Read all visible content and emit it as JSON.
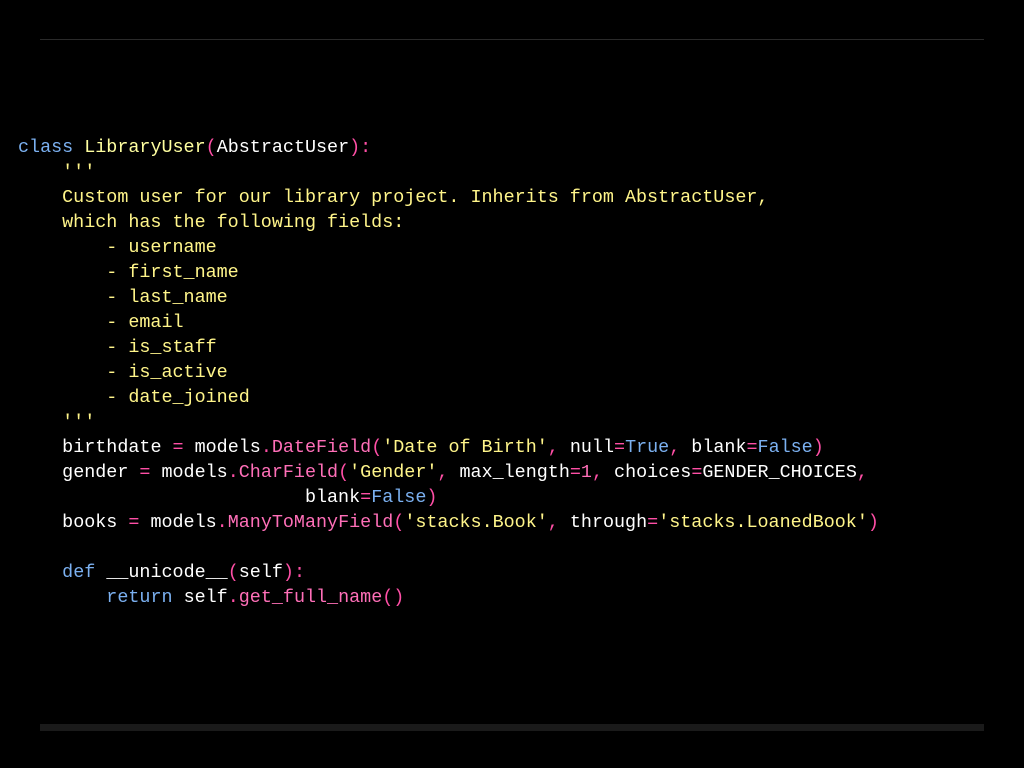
{
  "code": {
    "l1": {
      "kw": "class",
      "cls": "LibraryUser",
      "p1": "(",
      "base": "AbstractUser",
      "p2": "):"
    },
    "l2": {
      "text": "    '''"
    },
    "l3": {
      "text": "    Custom user for our library project. Inherits from AbstractUser,"
    },
    "l4": {
      "text": "    which has the following fields:"
    },
    "l5": {
      "text": "        - username"
    },
    "l6": {
      "text": "        - first_name"
    },
    "l7": {
      "text": "        - last_name"
    },
    "l8": {
      "text": "        - email"
    },
    "l9": {
      "text": "        - is_staff"
    },
    "l10": {
      "text": "        - is_active"
    },
    "l11": {
      "text": "        - date_joined"
    },
    "l12": {
      "text": "    '''"
    },
    "l13": {
      "indent": "    ",
      "var": "birthdate",
      "eq": " = ",
      "mod": "models",
      "dot": ".",
      "fn": "DateField",
      "po": "(",
      "s1": "'Date of Birth'",
      "c1": ", ",
      "k1": "null",
      "e1": "=",
      "v1": "True",
      "c2": ", ",
      "k2": "blank",
      "e2": "=",
      "v2": "False",
      "pc": ")"
    },
    "l14": {
      "indent": "    ",
      "var": "gender",
      "eq": " = ",
      "mod": "models",
      "dot": ".",
      "fn": "CharField",
      "po": "(",
      "s1": "'Gender'",
      "c1": ", ",
      "k1": "max_length",
      "e1": "=",
      "v1": "1",
      "c2": ", ",
      "k2": "choices",
      "e2": "=",
      "v2": "GENDER_CHOICES",
      "c3": ","
    },
    "l15": {
      "indent": "                          ",
      "k1": "blank",
      "e1": "=",
      "v1": "False",
      "pc": ")"
    },
    "l16": {
      "indent": "    ",
      "var": "books",
      "eq": " = ",
      "mod": "models",
      "dot": ".",
      "fn": "ManyToManyField",
      "po": "(",
      "s1": "'stacks.Book'",
      "c1": ", ",
      "k1": "through",
      "e1": "=",
      "s2": "'stacks.LoanedBook'",
      "pc": ")"
    },
    "l17": {
      "text": ""
    },
    "l18": {
      "indent": "    ",
      "kw": "def",
      "sp": " ",
      "name": "__unicode__",
      "po": "(",
      "arg": "self",
      "pc": "):"
    },
    "l19": {
      "indent": "        ",
      "kw": "return",
      "sp": " ",
      "obj": "self",
      "dot": ".",
      "fn": "get_full_name",
      "call": "()"
    }
  }
}
